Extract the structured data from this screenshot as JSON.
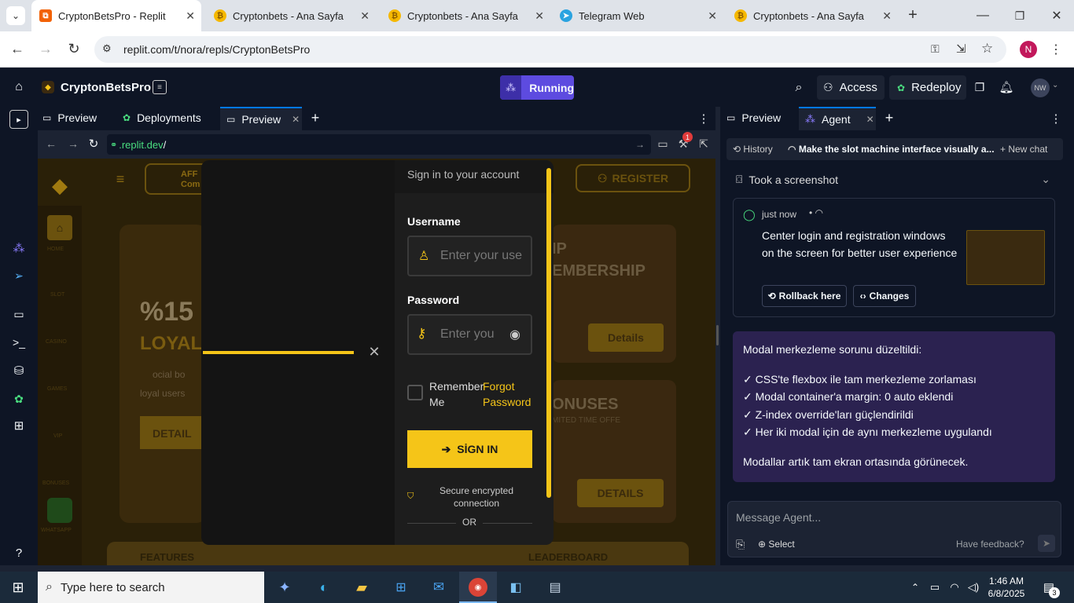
{
  "browser": {
    "tabs": [
      {
        "title": "CryptonBetsPro - Replit",
        "active": true
      },
      {
        "title": "Cryptonbets - Ana Sayfa",
        "active": false
      },
      {
        "title": "Cryptonbets - Ana Sayfa",
        "active": false
      },
      {
        "title": "Telegram Web",
        "active": false
      },
      {
        "title": "Cryptonbets - Ana Sayfa",
        "active": false
      }
    ],
    "url": "replit.com/t/nora/repls/CryptonBetsPro",
    "profile_initial": "N"
  },
  "replit": {
    "project_name": "CryptonBetsPro",
    "run_status": "Running",
    "access_label": "Access",
    "redeploy_label": "Redeploy",
    "user_initials": "NW",
    "workspace_tabs": [
      "Preview",
      "Deployments",
      "Preview"
    ],
    "preview_url_prefix": ".replit.dev",
    "preview_url_path": "/",
    "notification_count": "1"
  },
  "site": {
    "affiliate_label": "AFF",
    "affiliate_sub": "Com",
    "register_label": "REGISTER",
    "promo_percent": "%15",
    "promo_word": "LOYAL",
    "promo_text1": "ocial bo",
    "promo_text2": "loyal users",
    "details_left": "DETAIL",
    "vip_line1": "IP",
    "vip_line2": "EMBERSHIP",
    "details_vip": "Details",
    "bonuses_label": "ONUSES",
    "bonuses_sub": "MITED TIME OFFE",
    "details_bonus": "DETAILS",
    "features_label": "FEATURES",
    "leaderboard_label": "LEADERBOARD",
    "side_nav": [
      "HOME",
      "SLOT",
      "CASINO",
      "GAMES",
      "VIP",
      "BONUSES",
      "WHATSAPP"
    ]
  },
  "modal": {
    "title": "Sign in to your account",
    "username_label": "Username",
    "username_placeholder": "Enter your use",
    "password_label": "Password",
    "password_placeholder": "Enter you",
    "remember_label": "Remember Me",
    "forgot_label": "Forgot Password",
    "signin_label": "SİGN IN",
    "secure_text": "Secure encrypted connection",
    "or_text": "OR"
  },
  "agent": {
    "tabs": [
      "Preview",
      "Agent"
    ],
    "history_label": "History",
    "chat_title": "Make the slot machine interface visually a...",
    "new_chat_label": "New chat",
    "screenshot_label": "Took a screenshot",
    "checkpoint_time": "just now",
    "checkpoint_text": "Center login and registration windows on the screen for better user experience",
    "rollback_label": "Rollback here",
    "changes_label": "Changes",
    "message_lines": [
      "Modal merkezleme sorunu düzeltildi:",
      "✓ CSS'te flexbox ile tam merkezleme zorlaması",
      "✓ Modal container'a margin: 0 auto eklendi",
      "✓ Z-index override'ları güçlendirildi",
      "✓ Her iki modal için de aynı merkezleme uygulandı",
      "Modallar artık tam ekran ortasında görünecek."
    ],
    "input_placeholder": "Message Agent...",
    "select_label": "Select",
    "feedback_label": "Have feedback?"
  },
  "taskbar": {
    "search_placeholder": "Type here to search",
    "time": "1:46 AM",
    "date": "6/8/2025",
    "notif_count": "3"
  },
  "colors": {
    "gold": "#f5c518",
    "replit_bg": "#0e1525",
    "agent_bubble": "#2b2250",
    "running": "#6b4bff"
  }
}
